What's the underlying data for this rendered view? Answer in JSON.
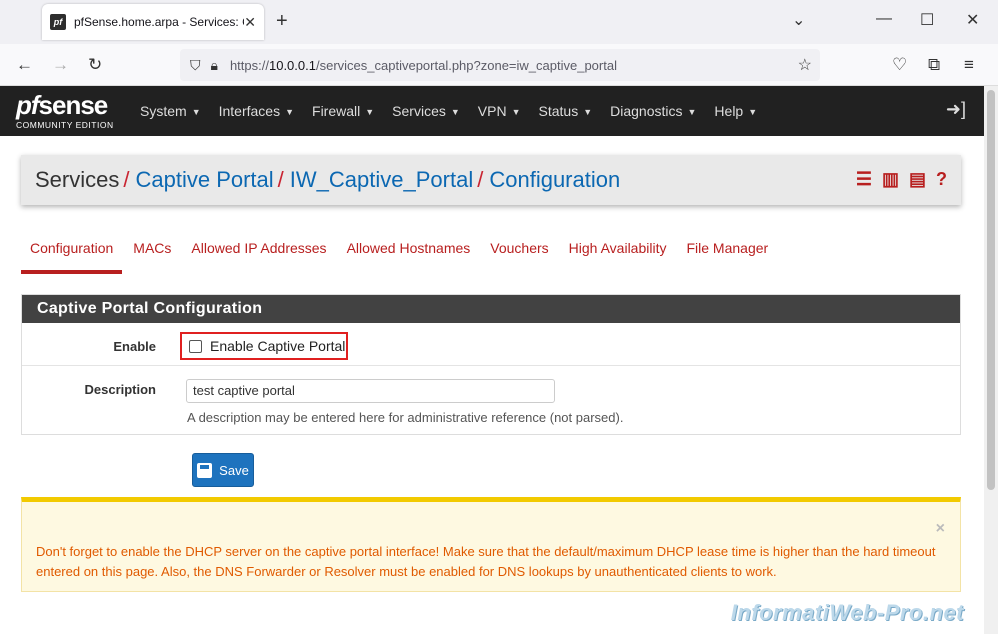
{
  "browser": {
    "tab_title": "pfSense.home.arpa - Services: C",
    "favicon_text": "pf",
    "url_scheme": "https://",
    "url_host": "10.0.0.1",
    "url_path": "/services_captiveportal.php?zone=iw_captive_portal"
  },
  "pfsense": {
    "logo_pf": "pf",
    "logo_sense": "sense",
    "edition": "COMMUNITY EDITION",
    "menu": [
      "System",
      "Interfaces",
      "Firewall",
      "Services",
      "VPN",
      "Status",
      "Diagnostics",
      "Help"
    ]
  },
  "breadcrumb": {
    "items": [
      "Services",
      "Captive Portal",
      "IW_Captive_Portal",
      "Configuration"
    ],
    "separator": "/"
  },
  "tabs": [
    "Configuration",
    "MACs",
    "Allowed IP Addresses",
    "Allowed Hostnames",
    "Vouchers",
    "High Availability",
    "File Manager"
  ],
  "panel": {
    "title": "Captive Portal Configuration",
    "enable_label": "Enable",
    "enable_checkbox_label": "Enable Captive Portal",
    "description_label": "Description",
    "description_value": "test captive portal",
    "description_help": "A description may be entered here for administrative reference (not parsed)."
  },
  "save_label": "Save",
  "alert": {
    "message": "Don't forget to enable the DHCP server on the captive portal interface! Make sure that the default/maximum DHCP lease time is higher than the hard timeout entered on this page. Also, the DNS Forwarder or Resolver must be enabled for DNS lookups by unauthenticated clients to work.",
    "close": "×"
  },
  "watermark": "InformatiWeb-Pro.net",
  "colors": {
    "accent_red": "#b81f1f",
    "link_blue": "#0c68b2",
    "header_dark": "#212121",
    "alert_text": "#e05a00"
  }
}
